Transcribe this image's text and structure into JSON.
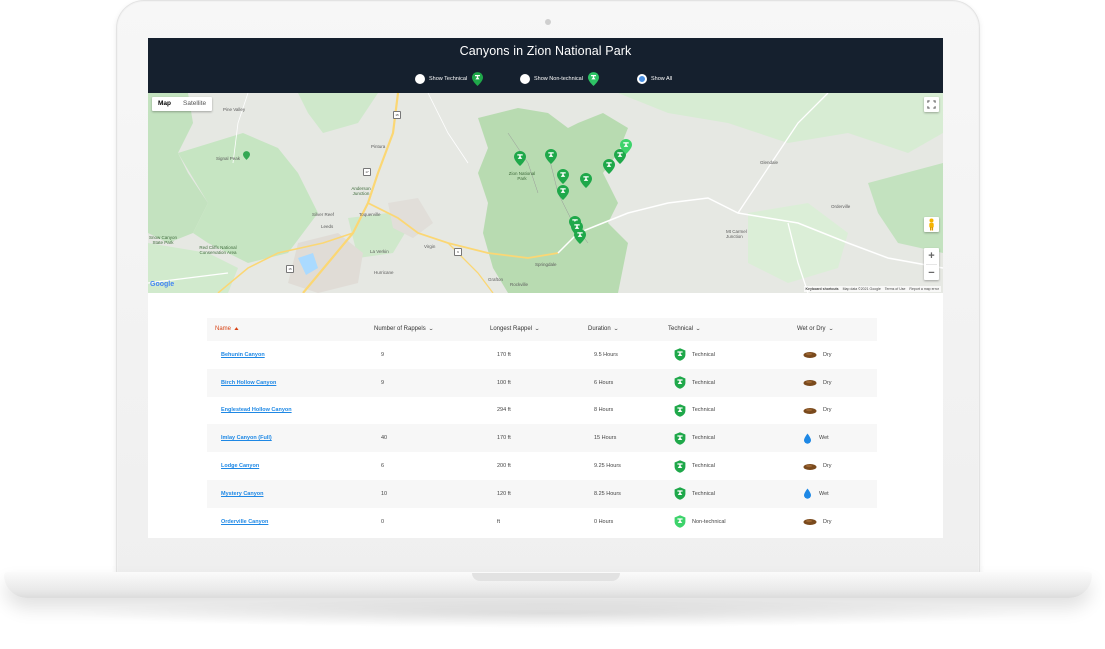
{
  "header": {
    "title": "Canyons in Zion National Park",
    "filters": [
      {
        "label": "Show Technical",
        "checked": false,
        "icon": "technical-canyon-pin-icon"
      },
      {
        "label": "Show Non-technical",
        "checked": false,
        "icon": "non-technical-canyon-pin-icon"
      },
      {
        "label": "Show All",
        "checked": true
      }
    ]
  },
  "map": {
    "type_buttons": [
      "Map",
      "Satellite"
    ],
    "labels": {
      "pine_valley": "Pine Valley",
      "signal_peak": "Signal Peak",
      "pintura": "Pintura",
      "anderson": "Anderson Junction",
      "toquerville": "Toquerville",
      "silver_reef": "Silver Reef",
      "leeds": "Leeds",
      "la_verkin": "La Verkin",
      "virgin": "Virgin",
      "hurricane": "Hurricane",
      "grafton": "Grafton",
      "rockville": "Rockville",
      "springdale": "Springdale",
      "zion": "Zion National Park",
      "red_cliffs": "Red Cliffs National Conservation Area",
      "snow_canyon": "Snow Canyon State Park",
      "glendale": "Glendale",
      "orderville": "Orderville",
      "mt_carmel": "Mt Carmel Junction"
    },
    "route_badges": [
      "15",
      "17",
      "9"
    ],
    "google": "Google",
    "footer": [
      "Keyboard shortcuts",
      "Map data ©2021 Google",
      "Terms of Use",
      "Report a map error"
    ],
    "colors": {
      "park": "#c3e2bf",
      "road": "#fbd774",
      "water": "#aadaff",
      "pin": "#1fa84a",
      "pin_light": "#3dd36b"
    }
  },
  "table": {
    "columns": [
      "Name",
      "Number of Rappels",
      "Longest Rappel",
      "Duration",
      "Technical",
      "Wet or Dry"
    ],
    "sorted_column": "Name",
    "rows": [
      {
        "name": "Behunin Canyon",
        "rappels": "9",
        "longest": "170 ft",
        "duration": "9.5 Hours",
        "technical": "Technical",
        "wet_dry": "Dry"
      },
      {
        "name": "Birch Hollow Canyon",
        "rappels": "9",
        "longest": "100 ft",
        "duration": "6 Hours",
        "technical": "Technical",
        "wet_dry": "Dry"
      },
      {
        "name": "Englestead Hollow Canyon",
        "rappels": "",
        "longest": "294 ft",
        "duration": "8 Hours",
        "technical": "Technical",
        "wet_dry": "Dry"
      },
      {
        "name": "Imlay Canyon (Full)",
        "rappels": "40",
        "longest": "170 ft",
        "duration": "15 Hours",
        "technical": "Technical",
        "wet_dry": "Wet"
      },
      {
        "name": "Lodge Canyon",
        "rappels": "6",
        "longest": "200 ft",
        "duration": "9.25 Hours",
        "technical": "Technical",
        "wet_dry": "Dry"
      },
      {
        "name": "Mystery Canyon",
        "rappels": "10",
        "longest": "120 ft",
        "duration": "8.25 Hours",
        "technical": "Technical",
        "wet_dry": "Wet"
      },
      {
        "name": "Orderville Canyon",
        "rappels": "0",
        "longest": "ft",
        "duration": "0 Hours",
        "technical": "Non-technical",
        "wet_dry": "Dry"
      }
    ]
  }
}
